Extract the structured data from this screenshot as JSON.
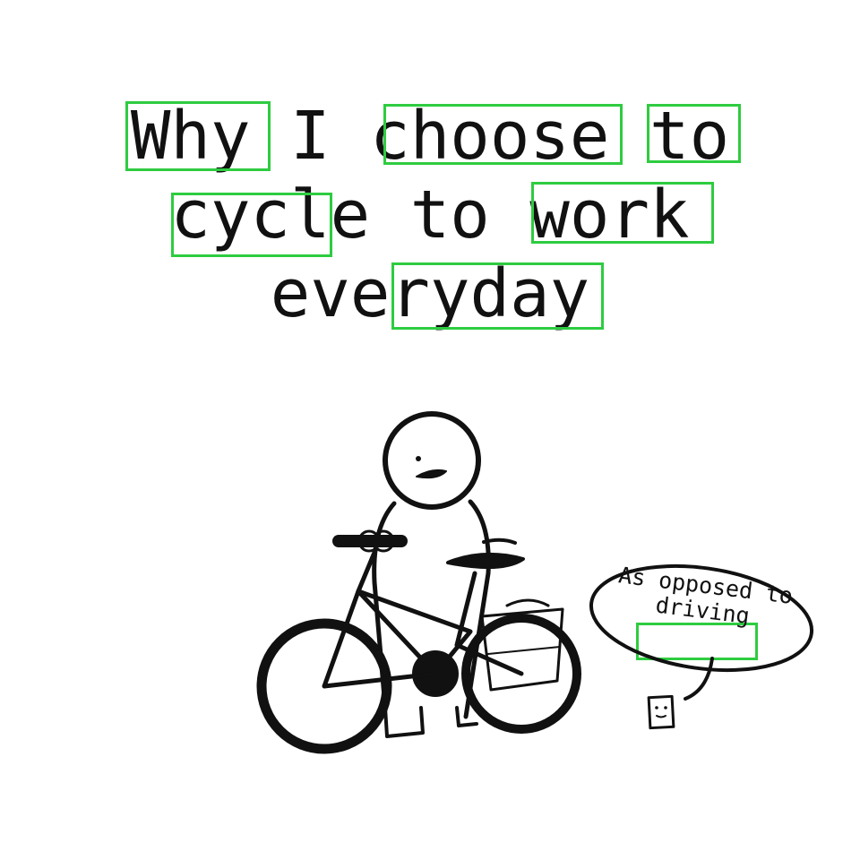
{
  "title": {
    "line1": "Why I choose to",
    "line2": "cycle to work",
    "line3": "everyday"
  },
  "speech_bubble": {
    "line1": "As opposed to",
    "line2": "driving"
  },
  "colors": {
    "ink": "#111111",
    "box_outline": "#2ecc40",
    "background": "#ffffff"
  },
  "icons": {
    "figure": "stick-person-icon",
    "bicycle": "bicycle-icon",
    "small_figure": "small-person-icon",
    "bubble": "speech-bubble-icon"
  }
}
